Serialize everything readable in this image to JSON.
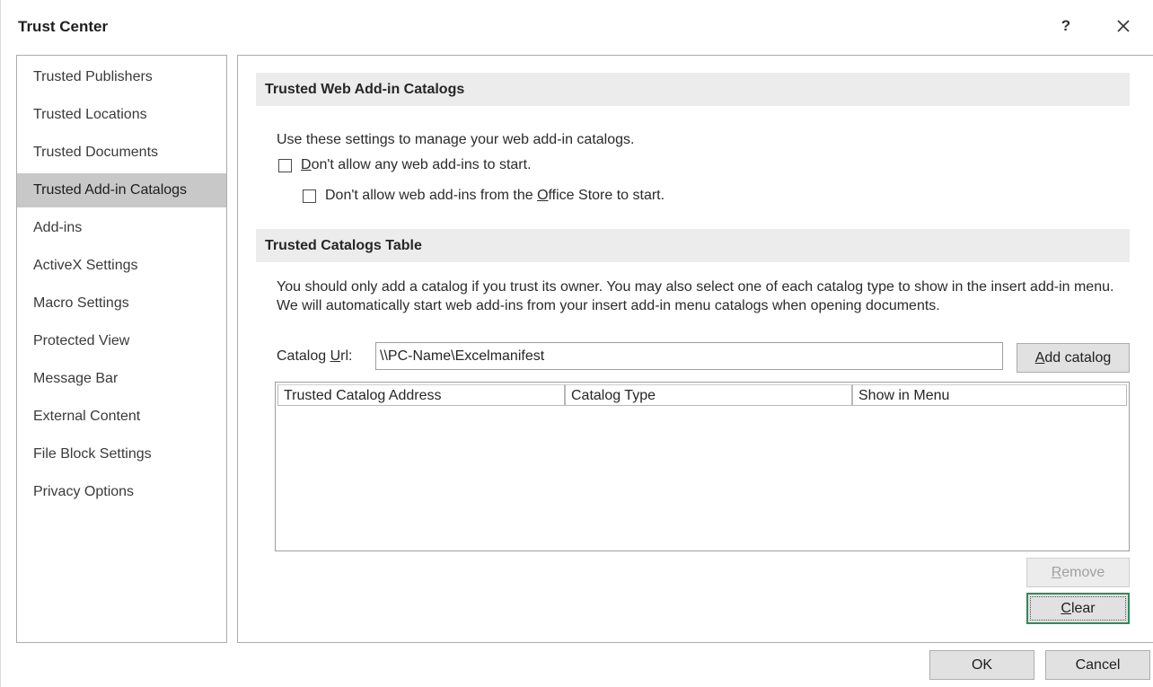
{
  "window": {
    "title": "Trust Center",
    "help_label": "?",
    "close_icon": "close-icon"
  },
  "sidebar": {
    "items": [
      {
        "label": "Trusted Publishers",
        "active": false
      },
      {
        "label": "Trusted Locations",
        "active": false
      },
      {
        "label": "Trusted Documents",
        "active": false
      },
      {
        "label": "Trusted Add-in Catalogs",
        "active": true
      },
      {
        "label": "Add-ins",
        "active": false
      },
      {
        "label": "ActiveX Settings",
        "active": false
      },
      {
        "label": "Macro Settings",
        "active": false
      },
      {
        "label": "Protected View",
        "active": false
      },
      {
        "label": "Message Bar",
        "active": false
      },
      {
        "label": "External Content",
        "active": false
      },
      {
        "label": "File Block Settings",
        "active": false
      },
      {
        "label": "Privacy Options",
        "active": false
      }
    ]
  },
  "web_catalogs": {
    "header": "Trusted Web Add-in Catalogs",
    "description": "Use these settings to manage your web add-in catalogs.",
    "checkbox_all": {
      "label_pre": "",
      "label_key": "D",
      "label_post": "on't allow any web add-ins to start.",
      "checked": false
    },
    "checkbox_store": {
      "label_pre": "Don't allow web add-ins from the ",
      "label_key": "O",
      "label_post": "ffice Store to start.",
      "checked": false
    }
  },
  "catalogs_table": {
    "header": "Trusted Catalogs Table",
    "note": "You should only add a catalog if you trust its owner. You may also select one of each catalog type to show in the insert add-in menu. We will automatically start web add-ins from your insert add-in menu catalogs when opening documents.",
    "url_label_pre": "Catalog ",
    "url_label_key": "U",
    "url_label_post": "rl:",
    "url_value": "\\\\PC-Name\\Excelmanifest",
    "add_button": {
      "key": "A",
      "rest": "dd catalog"
    },
    "columns": [
      "Trusted Catalog Address",
      "Catalog Type",
      "Show in Menu"
    ],
    "rows": [],
    "remove_button": {
      "key": "R",
      "rest": "emove",
      "enabled": false
    },
    "clear_button": {
      "key": "C",
      "rest": "lear",
      "enabled": true
    }
  },
  "footer": {
    "ok_label": "OK",
    "cancel_label": "Cancel"
  },
  "colors": {
    "selected_nav": "#c8c8c8",
    "section_header_bg": "#ececec",
    "default_button_border": "#2e8b57"
  }
}
